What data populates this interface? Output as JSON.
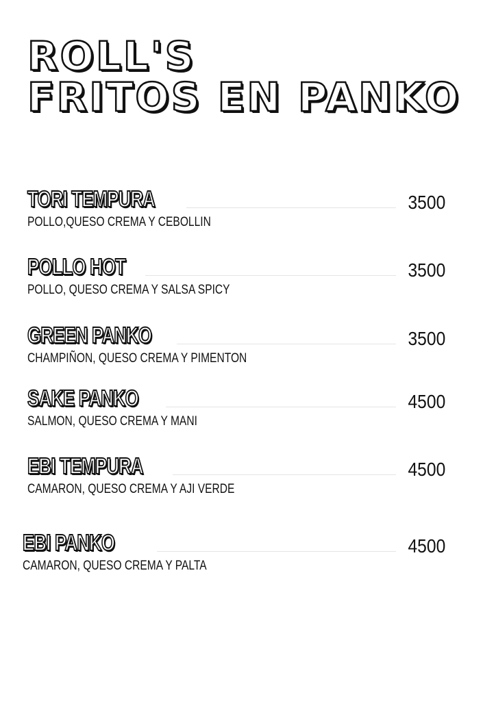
{
  "menu": {
    "title_line_1": "ROLL'S",
    "title_line_2": "FRITOS EN PANKO",
    "items": [
      {
        "name": "TORI TEMPURA",
        "description": "POLLO,QUESO CREMA Y CEBOLLIN",
        "price": "3500"
      },
      {
        "name": "POLLO HOT",
        "description": "POLLO, QUESO CREMA Y SALSA SPICY",
        "price": "3500"
      },
      {
        "name": "GREEN PANKO",
        "description": "CHAMPIÑON, QUESO CREMA Y PIMENTON",
        "price": "3500"
      },
      {
        "name": "SAKE PANKO",
        "description": "SALMON, QUESO CREMA Y MANI",
        "price": "4500"
      },
      {
        "name": "EBI TEMPURA",
        "description": "CAMARON, QUESO CREMA Y AJI VERDE",
        "price": "4500"
      },
      {
        "name": "EBI PANKO",
        "description": "CAMARON, QUESO CREMA Y PALTA",
        "price": "4500"
      }
    ]
  }
}
